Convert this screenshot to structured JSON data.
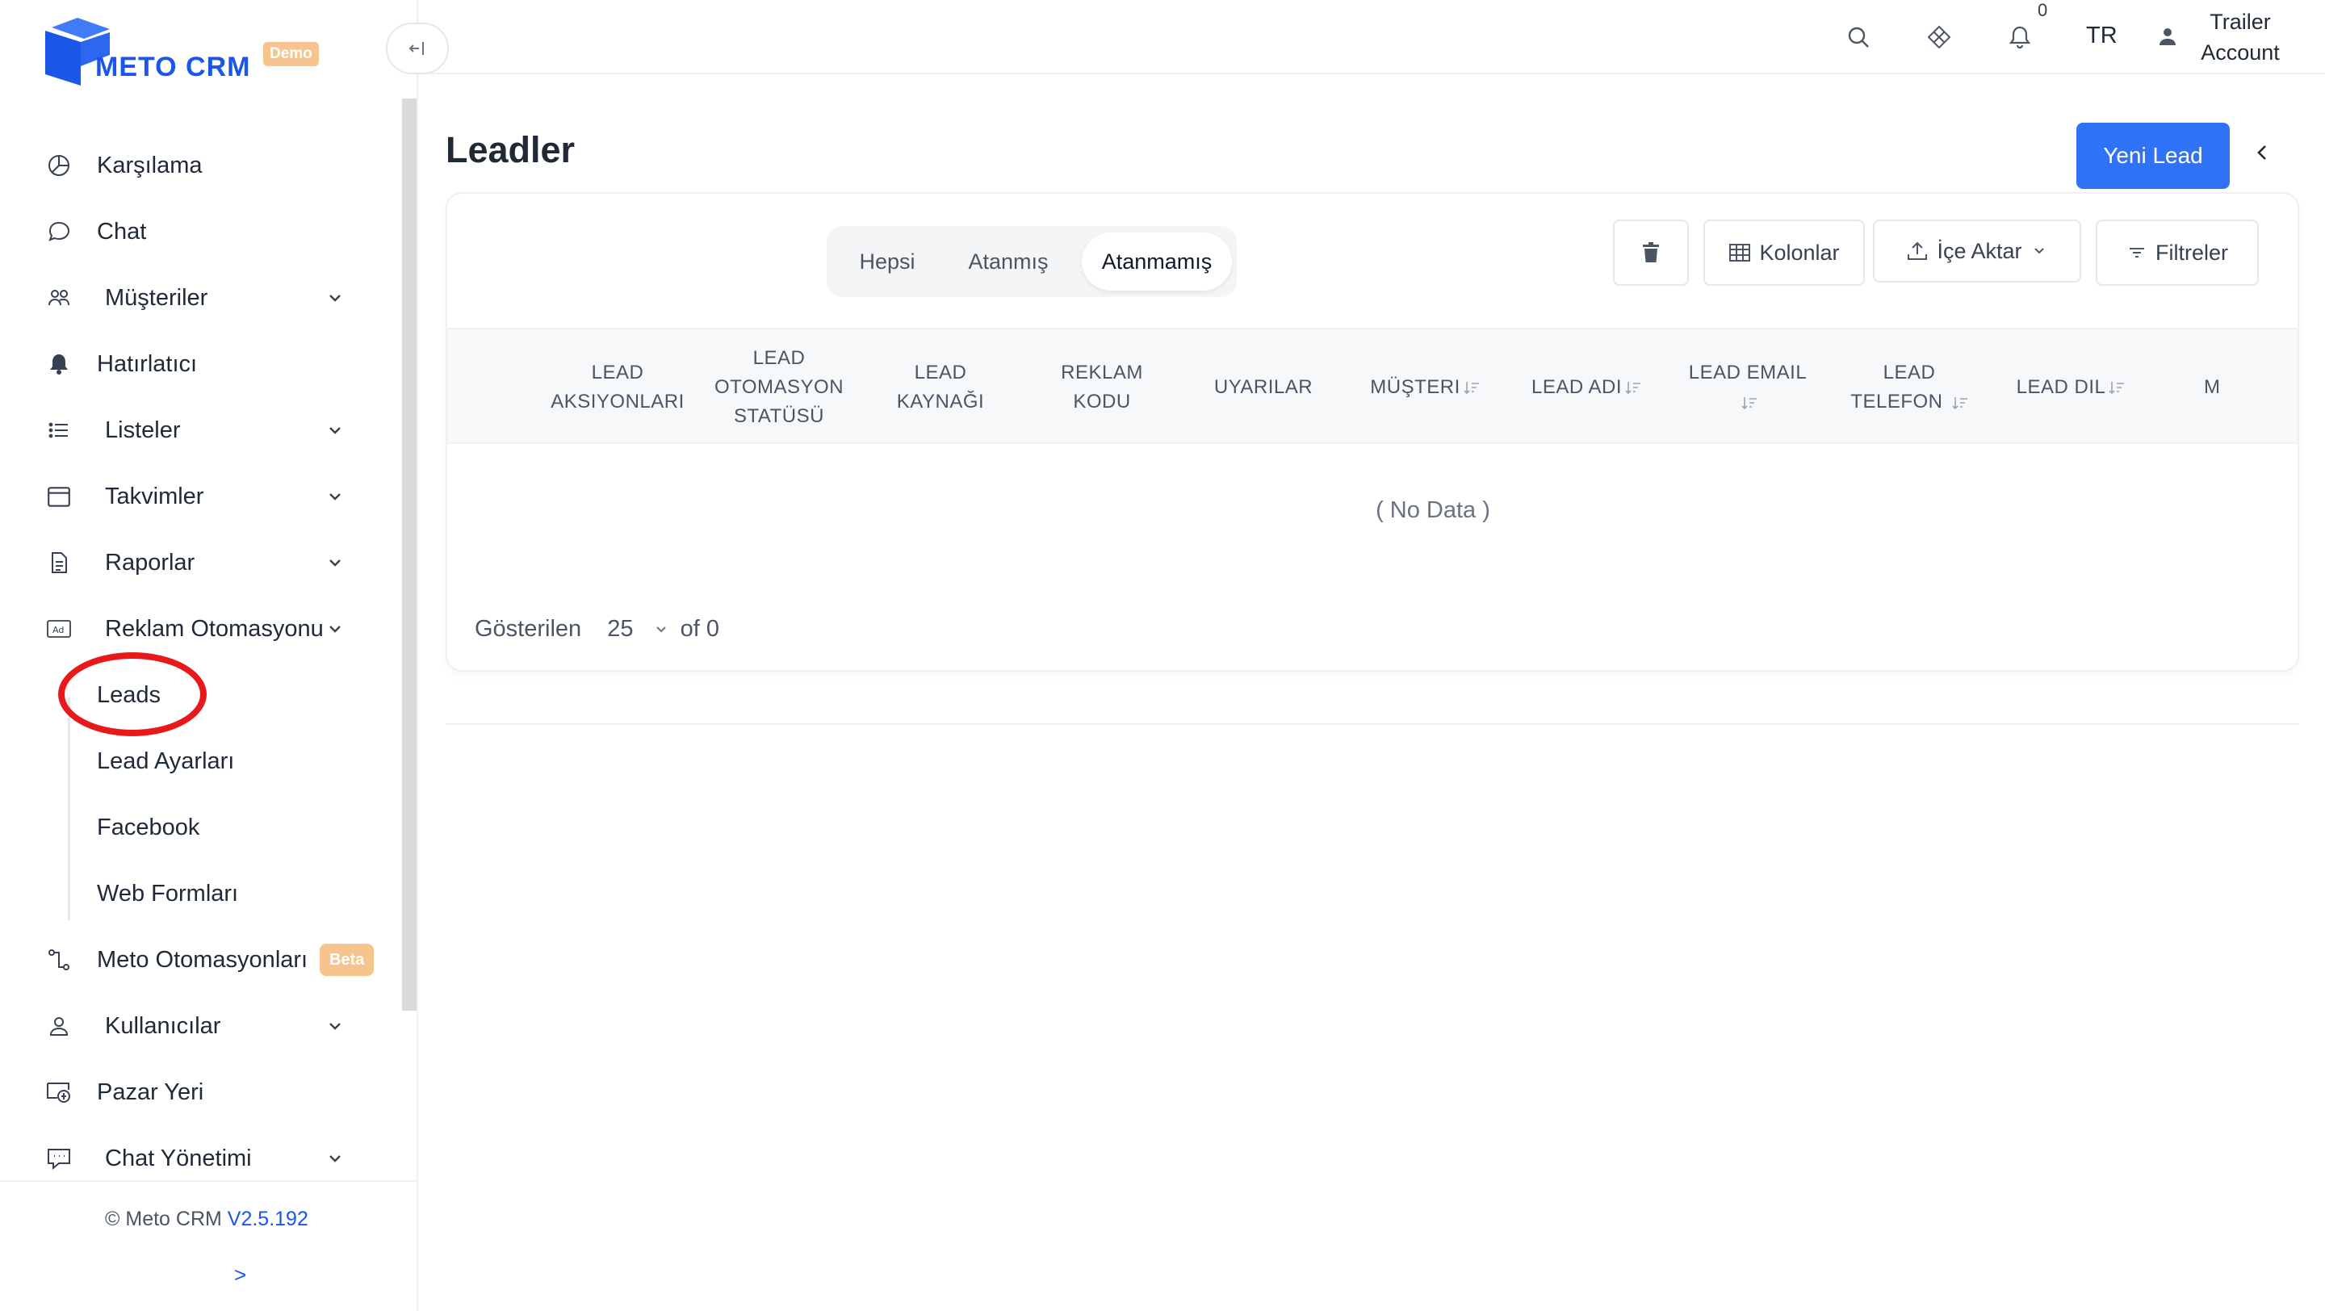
{
  "brand": {
    "name": "METO CRM",
    "badge": "Demo",
    "primary_color": "#1a56e8",
    "accent_color": "#f6c58f"
  },
  "sidebar": {
    "collapse_icon": "collapse-left-icon",
    "items": [
      {
        "label": "Karşılama",
        "icon": "dashboard-icon"
      },
      {
        "label": "Chat",
        "icon": "chat-bubble-icon"
      },
      {
        "label": "Müşteriler",
        "icon": "users-icon",
        "expandable": true
      },
      {
        "label": "Hatırlatıcı",
        "icon": "bell-icon"
      },
      {
        "label": "Listeler",
        "icon": "list-icon",
        "expandable": true
      },
      {
        "label": "Takvimler",
        "icon": "calendar-icon",
        "expandable": true
      },
      {
        "label": "Raporlar",
        "icon": "report-icon",
        "expandable": true
      },
      {
        "label": "Reklam Otomasyonu",
        "icon": "ad-icon",
        "expandable": true,
        "expanded": true
      }
    ],
    "subitems": [
      {
        "label": "Leads",
        "highlighted": true
      },
      {
        "label": "Lead Ayarları"
      },
      {
        "label": "Facebook"
      },
      {
        "label": "Web Formları"
      }
    ],
    "items_after": [
      {
        "label": "Meto Otomasyonları",
        "icon": "automation-icon",
        "badge": "Beta"
      },
      {
        "label": "Kullanıcılar",
        "icon": "user-icon",
        "expandable": true
      },
      {
        "label": "Pazar Yeri",
        "icon": "marketplace-icon"
      },
      {
        "label": "Chat Yönetimi",
        "icon": "chat-settings-icon",
        "expandable": true
      }
    ],
    "footer": {
      "copyright": "© Meto CRM",
      "version": "V2.5.192",
      "expand_label": ">"
    }
  },
  "topbar": {
    "notification_count": "0",
    "language": "TR",
    "account_line1": "Trailer",
    "account_line2": "Account"
  },
  "page": {
    "title": "Leadler",
    "new_button": "Yeni Lead"
  },
  "tabs": [
    {
      "label": "Hepsi",
      "active": false
    },
    {
      "label": "Atanmış",
      "active": false
    },
    {
      "label": "Atanmamış",
      "active": true
    }
  ],
  "toolbar": {
    "columns_label": "Kolonlar",
    "import_label": "İçe Aktar",
    "filters_label": "Filtreler"
  },
  "table": {
    "columns": [
      {
        "line1": "LEAD",
        "line2": "AKSIYONLARI",
        "line3": "",
        "sortable": false
      },
      {
        "line1": "LEAD",
        "line2": "OTOMASYON",
        "line3": "STATÜSÜ",
        "sortable": false
      },
      {
        "line1": "LEAD",
        "line2": "KAYNAĞI",
        "line3": "",
        "sortable": false
      },
      {
        "line1": "REKLAM",
        "line2": "KODU",
        "line3": "",
        "sortable": false
      },
      {
        "line1": "UYARILAR",
        "line2": "",
        "line3": "",
        "sortable": false
      },
      {
        "line1": "MÜŞTERI",
        "line2": "",
        "line3": "",
        "sortable": true
      },
      {
        "line1": "LEAD ADI",
        "line2": "",
        "line3": "",
        "sortable": true
      },
      {
        "line1": "LEAD EMAIL",
        "line2": "",
        "line3": "",
        "sortable": true
      },
      {
        "line1": "LEAD",
        "line2": "TELEFON",
        "line3": "",
        "sortable": true
      },
      {
        "line1": "LEAD DIL",
        "line2": "",
        "line3": "",
        "sortable": true
      },
      {
        "line1": "M",
        "line2": "",
        "line3": "",
        "sortable": false
      }
    ],
    "empty_text": "( No Data )"
  },
  "pagination": {
    "label": "Gösterilen",
    "page_size": "25",
    "of_text": "of 0"
  }
}
